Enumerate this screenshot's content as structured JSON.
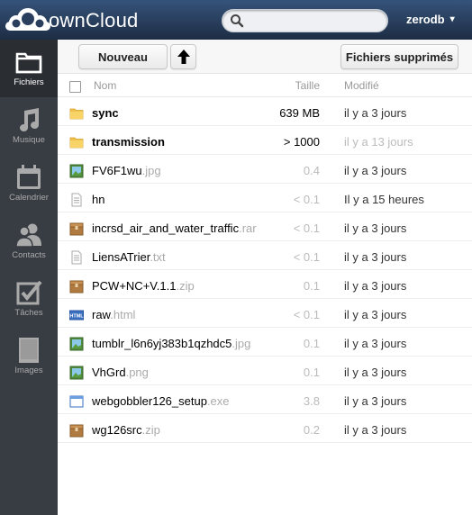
{
  "header": {
    "logo_text": "ownCloud",
    "search_placeholder": "",
    "username": "zerodb",
    "user_arrow": "▾"
  },
  "navigation": [
    {
      "label": "Fichiers",
      "icon": "folder-icon",
      "active": true
    },
    {
      "label": "Musique",
      "icon": "music-note-icon",
      "active": false
    },
    {
      "label": "Calendrier",
      "icon": "calendar-icon",
      "active": false
    },
    {
      "label": "Contacts",
      "icon": "people-icon",
      "active": false
    },
    {
      "label": "Tâches",
      "icon": "checkbox-icon",
      "active": false
    },
    {
      "label": "Images",
      "icon": "image-icon",
      "active": false
    }
  ],
  "controls": {
    "new_label": "Nouveau",
    "up_icon": "arrow-up-icon",
    "trash_label": "Fichiers supprimés"
  },
  "table": {
    "headers": {
      "name": "Nom",
      "size": "Taille",
      "date": "Modifié"
    },
    "rows": [
      {
        "base": "sync",
        "ext": "",
        "type": "folder",
        "size": "639 MB",
        "size_tone": "dark",
        "date": "il y a 3 jours",
        "date_tone": "dark"
      },
      {
        "base": "transmission",
        "ext": "",
        "type": "folder",
        "size": "> 1000",
        "size_tone": "dark",
        "date": "il y a 13 jours",
        "date_tone": "grey"
      },
      {
        "base": "FV6F1wu",
        "ext": ".jpg",
        "type": "image",
        "size": "0.4",
        "size_tone": "grey",
        "date": "il y a 3 jours",
        "date_tone": "dark"
      },
      {
        "base": "hn",
        "ext": "",
        "type": "text",
        "size": "< 0.1",
        "size_tone": "grey",
        "date": "Il y a 15 heures",
        "date_tone": "dark"
      },
      {
        "base": "incrsd_air_and_water_traffic",
        "ext": ".rar",
        "type": "archive",
        "size": "< 0.1",
        "size_tone": "grey",
        "date": "il y a 3 jours",
        "date_tone": "dark"
      },
      {
        "base": "LiensATrier",
        "ext": ".txt",
        "type": "text",
        "size": "< 0.1",
        "size_tone": "grey",
        "date": "il y a 3 jours",
        "date_tone": "dark"
      },
      {
        "base": "PCW+NC+V.1.1",
        "ext": ".zip",
        "type": "archive",
        "size": "0.1",
        "size_tone": "grey",
        "date": "il y a 3 jours",
        "date_tone": "dark"
      },
      {
        "base": "raw",
        "ext": ".html",
        "type": "html",
        "size": "< 0.1",
        "size_tone": "grey",
        "date": "il y a 3 jours",
        "date_tone": "dark"
      },
      {
        "base": "tumblr_l6n6yj383b1qzhdc5",
        "ext": ".jpg",
        "type": "image",
        "size": "0.1",
        "size_tone": "grey",
        "date": "il y a 3 jours",
        "date_tone": "dark"
      },
      {
        "base": "VhGrd",
        "ext": ".png",
        "type": "image",
        "size": "0.1",
        "size_tone": "grey",
        "date": "il y a 3 jours",
        "date_tone": "dark"
      },
      {
        "base": "webgobbler126_setup",
        "ext": ".exe",
        "type": "application",
        "size": "3.8",
        "size_tone": "grey",
        "date": "il y a 3 jours",
        "date_tone": "dark"
      },
      {
        "base": "wg126src",
        "ext": ".zip",
        "type": "archive",
        "size": "0.2",
        "size_tone": "grey",
        "date": "il y a 3 jours",
        "date_tone": "dark"
      }
    ]
  }
}
